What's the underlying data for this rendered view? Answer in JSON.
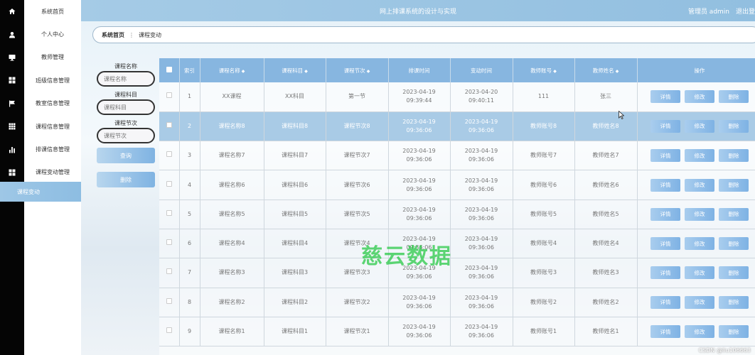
{
  "app": {
    "title": "网上排课系统的设计与实现",
    "user": "管理员 admin",
    "logout": "退出登"
  },
  "sidebar": {
    "items": [
      {
        "label": "系统首页",
        "icon": "home-icon"
      },
      {
        "label": "个人中心",
        "icon": "user-icon"
      },
      {
        "label": "教师管理",
        "icon": "monitor-icon"
      },
      {
        "label": "班级信息管理",
        "icon": "grid-icon"
      },
      {
        "label": "教室信息管理",
        "icon": "flag-icon"
      },
      {
        "label": "课程信息管理",
        "icon": "table-icon"
      },
      {
        "label": "排课信息管理",
        "icon": "bar-chart-icon"
      },
      {
        "label": "课程变动管理",
        "icon": "grid-icon"
      }
    ],
    "active_sub": "课程变动"
  },
  "breadcrumb": {
    "home": "系统首页",
    "separator": "⋮",
    "current": "课程变动"
  },
  "search": {
    "name_label": "课程名称",
    "name_placeholder": "课程名称",
    "subject_label": "课程科目",
    "subject_placeholder": "课程科目",
    "period_label": "课程节次",
    "period_placeholder": "课程节次",
    "query_button": "查询",
    "delete_button": "删除"
  },
  "table": {
    "columns": [
      "索引",
      "课程名称",
      "课程科目",
      "课程节次",
      "排课时间",
      "变动时间",
      "教师账号",
      "教师姓名",
      "操作"
    ],
    "rows": [
      {
        "index": "1",
        "name": "XX课程",
        "subject": "XX科目",
        "period": "第一节",
        "schedule_time": "2023-04-19 09:39:44",
        "change_time": "2023-04-20 09:40:11",
        "teacher_account": "111",
        "teacher_name": "张三"
      },
      {
        "index": "2",
        "name": "课程名称8",
        "subject": "课程科目8",
        "period": "课程节次8",
        "schedule_time": "2023-04-19 09:36:06",
        "change_time": "2023-04-19 09:36:06",
        "teacher_account": "教师账号8",
        "teacher_name": "教师姓名8"
      },
      {
        "index": "3",
        "name": "课程名称7",
        "subject": "课程科目7",
        "period": "课程节次7",
        "schedule_time": "2023-04-19 09:36:06",
        "change_time": "2023-04-19 09:36:06",
        "teacher_account": "教师账号7",
        "teacher_name": "教师姓名7"
      },
      {
        "index": "4",
        "name": "课程名称6",
        "subject": "课程科目6",
        "period": "课程节次6",
        "schedule_time": "2023-04-19 09:36:06",
        "change_time": "2023-04-19 09:36:06",
        "teacher_account": "教师账号6",
        "teacher_name": "教师姓名6"
      },
      {
        "index": "5",
        "name": "课程名称5",
        "subject": "课程科目5",
        "period": "课程节次5",
        "schedule_time": "2023-04-19 09:36:06",
        "change_time": "2023-04-19 09:36:06",
        "teacher_account": "教师账号5",
        "teacher_name": "教师姓名5"
      },
      {
        "index": "6",
        "name": "课程名称4",
        "subject": "课程科目4",
        "period": "课程节次4",
        "schedule_time": "2023-04-19 09:36:06",
        "change_time": "2023-04-19 09:36:06",
        "teacher_account": "教师账号4",
        "teacher_name": "教师姓名4"
      },
      {
        "index": "7",
        "name": "课程名称3",
        "subject": "课程科目3",
        "period": "课程节次3",
        "schedule_time": "2023-04-19 09:36:06",
        "change_time": "2023-04-19 09:36:06",
        "teacher_account": "教师账号3",
        "teacher_name": "教师姓名3"
      },
      {
        "index": "8",
        "name": "课程名称2",
        "subject": "课程科目2",
        "period": "课程节次2",
        "schedule_time": "2023-04-19 09:36:06",
        "change_time": "2023-04-19 09:36:06",
        "teacher_account": "教师账号2",
        "teacher_name": "教师姓名2"
      },
      {
        "index": "9",
        "name": "课程名称1",
        "subject": "课程科目1",
        "period": "课程节次1",
        "schedule_time": "2023-04-19 09:36:06",
        "change_time": "2023-04-19 09:36:06",
        "teacher_account": "教师账号1",
        "teacher_name": "教师姓名1"
      }
    ],
    "highlighted_row": 1,
    "actions": {
      "detail": "详情",
      "edit": "修改",
      "delete": "删除"
    }
  },
  "watermark": "慈云数据",
  "credit": "CSDN @liu106663",
  "colors": {
    "accent": "#87b6e0",
    "highlight_row": "#a9cbe6",
    "sidebar_bg": "#050505",
    "watermark": "#28c846"
  }
}
